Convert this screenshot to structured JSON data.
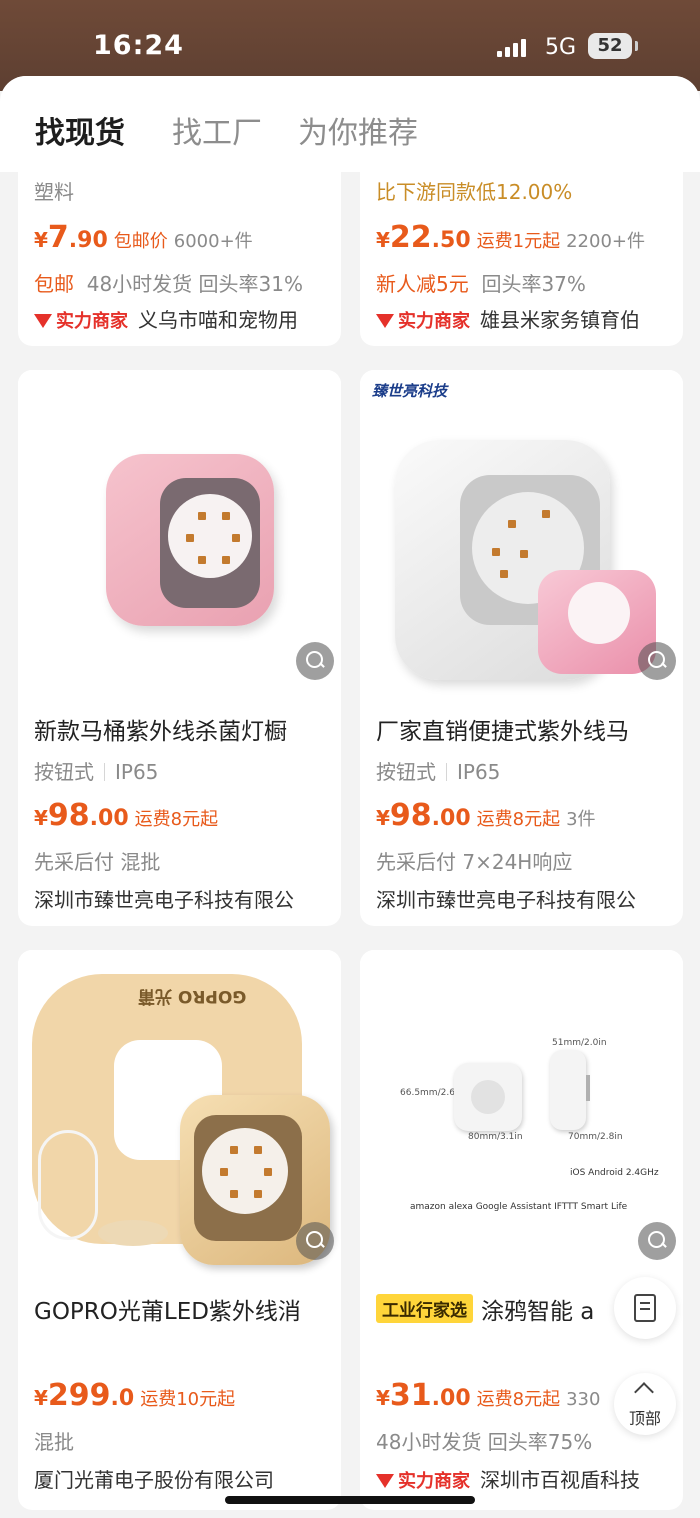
{
  "status": {
    "time": "16:24",
    "network": "5G",
    "battery": "52"
  },
  "tabs": [
    {
      "label": "找现货",
      "active": true
    },
    {
      "label": "找工厂",
      "active": false
    },
    {
      "label": "为你推荐",
      "active": false
    }
  ],
  "cards": [
    {
      "subtitle": "塑料",
      "price": {
        "yen": "¥",
        "int": "7",
        "dec": ".90",
        "shipping": "包邮价",
        "sold": "6000+件"
      },
      "tags": {
        "orange": "包邮",
        "gray": "48小时发货  回头率31%"
      },
      "badge": "实力商家",
      "shop": "义乌市喵和宠物用"
    },
    {
      "subtitle": "比下游同款低12.00%",
      "price": {
        "yen": "¥",
        "int": "22",
        "dec": ".50",
        "shipping": "运费1元起",
        "sold": "2200+件"
      },
      "tags": {
        "orange": "新人减5元",
        "gray": "回头率37%"
      },
      "badge": "实力商家",
      "shop": "雄县米家务镇育伯"
    },
    {
      "title": "新款马桶紫外线杀菌灯橱",
      "attr": [
        "按钮式",
        "IP65"
      ],
      "price": {
        "yen": "¥",
        "int": "98",
        "dec": ".00",
        "shipping": "运费8元起",
        "sold": ""
      },
      "tags": {
        "gray": "先采后付  混批"
      },
      "shop": "深圳市臻世亮电子科技有限公"
    },
    {
      "brand": "臻世亮科技",
      "title": "厂家直销便捷式紫外线马",
      "attr": [
        "按钮式",
        "IP65"
      ],
      "price": {
        "yen": "¥",
        "int": "98",
        "dec": ".00",
        "shipping": "运费8元起",
        "sold": "3件"
      },
      "tags": {
        "gray": "先采后付  7×24H响应"
      },
      "shop": "深圳市臻世亮电子科技有限公"
    },
    {
      "ring_text": "GOPRO 光莆",
      "title": "GOPRO光莆LED紫外线消",
      "price": {
        "yen": "¥",
        "int": "299",
        "dec": ".0",
        "shipping": "运费10元起",
        "sold": ""
      },
      "tags": {
        "gray": "混批"
      },
      "shop": "厦门光莆电子股份有限公司"
    },
    {
      "dims": {
        "h": "66.5mm/2.6in",
        "w": "80mm/3.1in",
        "d": "51mm/2.0in",
        "l": "70mm/2.8in"
      },
      "compat": "amazon alexa   Google Assistant   IFTTT   Smart Life",
      "os": "iOS  Android  2.4GHz",
      "industry_tag": "工业行家选",
      "title": "涂鸦智能 a",
      "price": {
        "yen": "¥",
        "int": "31",
        "dec": ".00",
        "shipping": "运费8元起",
        "sold": "330"
      },
      "tags": {
        "gray": "48小时发货  回头率75%"
      },
      "badge": "实力商家",
      "shop": "深圳市百视盾科技"
    }
  ],
  "floating": {
    "top_label": "顶部"
  },
  "icons": [
    "signal-icon",
    "battery-icon",
    "image-search-icon",
    "merchant-badge-icon",
    "document-icon",
    "back-to-top-icon"
  ]
}
